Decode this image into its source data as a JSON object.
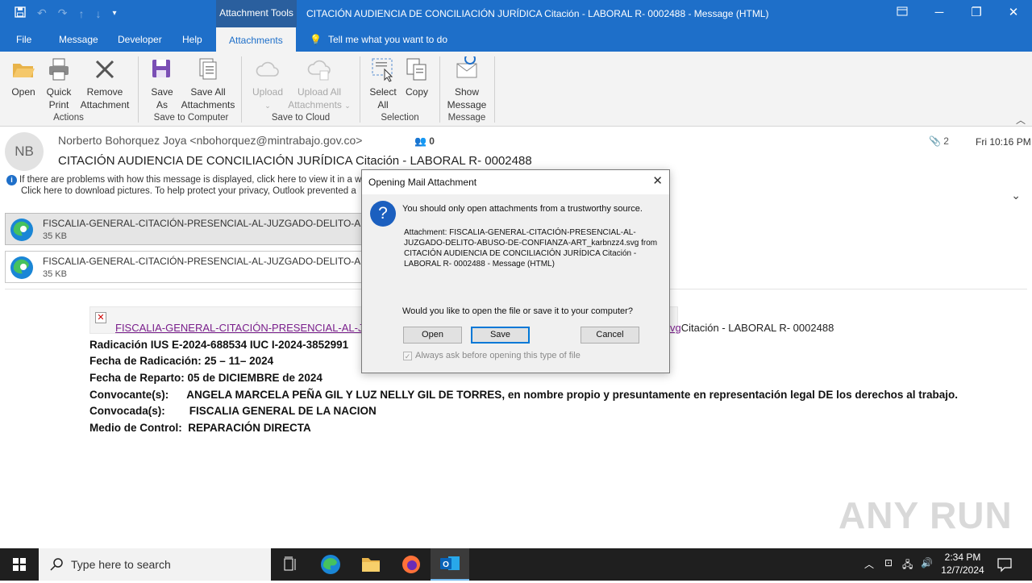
{
  "titlebar": {
    "context_tab": "Attachment Tools",
    "window_title": "CITACIÓN AUDIENCIA DE CONCILIACIÓN JURÍDICA Citación - LABORAL R- 0002488  -  Message (HTML)",
    "quick_access": [
      "save-icon",
      "undo-icon",
      "redo-icon",
      "up-icon",
      "down-icon",
      "customize-icon"
    ]
  },
  "menu": {
    "tabs": [
      "File",
      "Message",
      "Developer",
      "Help",
      "Attachments"
    ],
    "tell_me": "Tell me what you want to do"
  },
  "ribbon": {
    "open": "Open",
    "quick_print": [
      "Quick",
      "Print"
    ],
    "remove": [
      "Remove",
      "Attachment"
    ],
    "save_as": [
      "Save",
      "As"
    ],
    "save_all": [
      "Save All",
      "Attachments"
    ],
    "upload": "Upload",
    "upload_all": [
      "Upload All",
      "Attachments"
    ],
    "select_all": [
      "Select",
      "All"
    ],
    "copy": "Copy",
    "show_message": [
      "Show",
      "Message"
    ],
    "groups": [
      "Actions",
      "Save to Computer",
      "Save to Cloud",
      "Selection",
      "Message"
    ]
  },
  "header": {
    "avatar": "NB",
    "sender": "Norberto Bohorquez Joya <nbohorquez@mintrabajo.gov.co>",
    "people_count": "0",
    "subject": "CITACIÓN AUDIENCIA DE CONCILIACIÓN JURÍDICA Citación - LABORAL R- 0002488",
    "attachment_count": "2",
    "date": "Fri 10:16 PM",
    "info_line1": "If there are problems with how this message is displayed, click here to view it in a w",
    "info_line2": "Click here to download pictures. To help protect your privacy, Outlook prevented a"
  },
  "attachments": [
    {
      "name": "FISCALIA-GENERAL-CITACIÓN-PRESENCIAL-AL-JUZGADO-DELITO-ABUSO-",
      "size": "35 KB"
    },
    {
      "name": "FISCALIA-GENERAL-CITACIÓN-PRESENCIAL-AL-JUZGADO-DELITO-ABUSO-",
      "size": "35 KB"
    }
  ],
  "body": {
    "link": "FISCALIA-GENERAL-CITACIÓN-PRESENCIAL-AL-J",
    "link_tail_underlined": "vg",
    "link_tail_text": "Citación - LABORAL R- 0002488",
    "lines": [
      "Radicación IUS E-2024-688534 IUC I-2024-3852991",
      "Fecha de Radicación: 25 – 11– 2024",
      "Fecha de Reparto: 05 de DICIEMBRE de 2024",
      "Convocante(s):      ANGELA MARCELA PEÑA GIL Y LUZ NELLY GIL DE TORRES, en nombre propio y presuntamente en representación legal DE los derechos al trabajo.",
      "Convocada(s):        FISCALIA GENERAL DE LA NACION",
      "Medio de Control:  REPARACIÓN DIRECTA"
    ]
  },
  "dialog": {
    "title": "Opening Mail Attachment",
    "warning": "You should only open attachments from a trustworthy source.",
    "info": "Attachment: FISCALIA-GENERAL-CITACIÓN-PRESENCIAL-AL-JUZGADO-DELITO-ABUSO-DE-CONFIANZA-ART_karbnzz4.svg from CITACIÓN AUDIENCIA DE CONCILIACIÓN JURÍDICA Citación - LABORAL R- 0002488 - Message (HTML)",
    "question": "Would you like to open the file or save it to your computer?",
    "open_btn": "Open",
    "save_btn": "Save",
    "cancel_btn": "Cancel",
    "checkbox": "Always ask before opening this type of file"
  },
  "watermark": "ANY RUN",
  "taskbar": {
    "search_placeholder": "Type here to search",
    "time": "2:34 PM",
    "date": "12/7/2024"
  },
  "colors": {
    "accent": "#1e6fc9",
    "link": "#7a1f8c",
    "taskbar": "#1f1f1f"
  }
}
